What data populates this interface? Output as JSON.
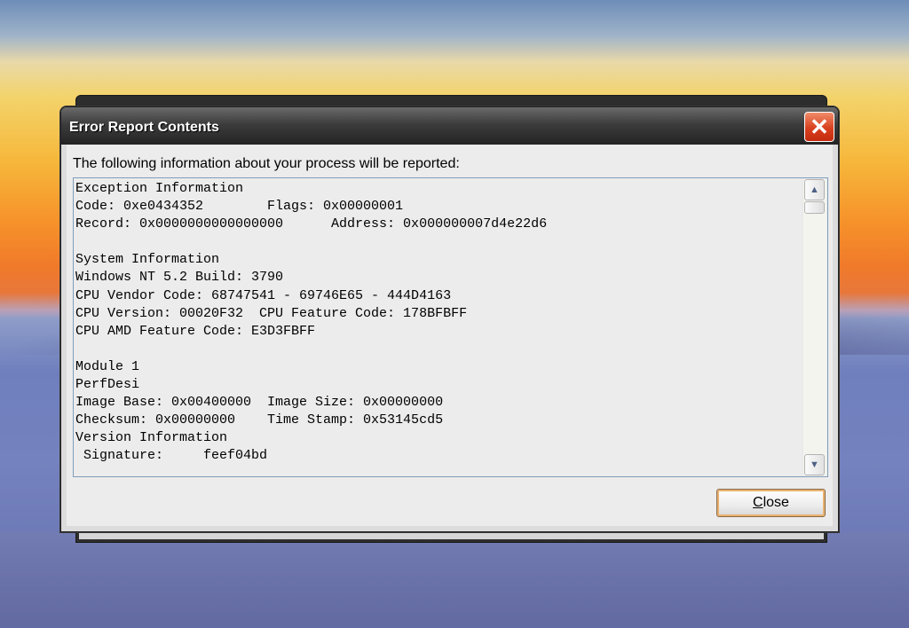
{
  "dialog": {
    "title": "Error Report Contents",
    "intro": "The following information about your process will be reported:",
    "close_button": {
      "accel": "C",
      "rest": "lose"
    }
  },
  "report_lines": [
    "Exception Information",
    "Code: 0xe0434352        Flags: 0x00000001",
    "Record: 0x0000000000000000      Address: 0x000000007d4e22d6",
    "",
    "System Information",
    "Windows NT 5.2 Build: 3790",
    "CPU Vendor Code: 68747541 - 69746E65 - 444D4163",
    "CPU Version: 00020F32  CPU Feature Code: 178BFBFF",
    "CPU AMD Feature Code: E3D3FBFF",
    "",
    "Module 1",
    "PerfDesi",
    "Image Base: 0x00400000  Image Size: 0x00000000",
    "Checksum: 0x00000000    Time Stamp: 0x53145cd5",
    "Version Information",
    " Signature:     feef04bd"
  ],
  "icons": {
    "close": "close-icon",
    "scroll_up": "scroll-up-arrow-icon",
    "scroll_down": "scroll-down-arrow-icon"
  },
  "colors": {
    "titlebar": "#242424",
    "close_red": "#d8401e",
    "button_focus": "#e9b26f"
  }
}
